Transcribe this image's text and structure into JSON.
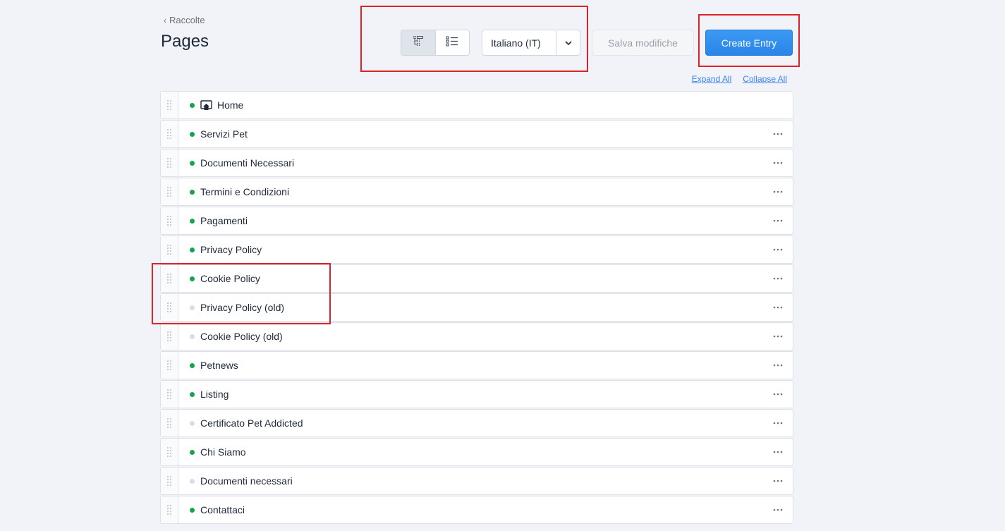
{
  "header": {
    "breadcrumb_label": "Raccolte",
    "title": "Pages",
    "locale": "Italiano (IT)",
    "save_label": "Salva modifiche",
    "create_label": "Create Entry",
    "expand_all": "Expand All",
    "collapse_all": "Collapse All"
  },
  "colors": {
    "published": "#16a34a",
    "draft": "#d9dde3",
    "primary": "#2a85e8",
    "highlight": "#d9252a"
  },
  "tree": {
    "rows": [
      {
        "label": "Home",
        "status": "published",
        "is_home": true,
        "has_menu": false
      },
      {
        "label": "Servizi Pet",
        "status": "published",
        "is_home": false,
        "has_menu": true
      },
      {
        "label": "Documenti Necessari",
        "status": "published",
        "is_home": false,
        "has_menu": true
      },
      {
        "label": "Termini e Condizioni",
        "status": "published",
        "is_home": false,
        "has_menu": true
      },
      {
        "label": "Pagamenti",
        "status": "published",
        "is_home": false,
        "has_menu": true
      },
      {
        "label": "Privacy Policy",
        "status": "published",
        "is_home": false,
        "has_menu": true
      },
      {
        "label": "Cookie Policy",
        "status": "published",
        "is_home": false,
        "has_menu": true
      },
      {
        "label": "Privacy Policy (old)",
        "status": "draft",
        "is_home": false,
        "has_menu": true
      },
      {
        "label": "Cookie Policy (old)",
        "status": "draft",
        "is_home": false,
        "has_menu": true
      },
      {
        "label": "Petnews",
        "status": "published",
        "is_home": false,
        "has_menu": true
      },
      {
        "label": "Listing",
        "status": "published",
        "is_home": false,
        "has_menu": true
      },
      {
        "label": "Certificato Pet Addicted",
        "status": "draft",
        "is_home": false,
        "has_menu": true
      },
      {
        "label": "Chi Siamo",
        "status": "published",
        "is_home": false,
        "has_menu": true
      },
      {
        "label": "Documenti necessari",
        "status": "draft",
        "is_home": false,
        "has_menu": true
      },
      {
        "label": "Contattaci",
        "status": "published",
        "is_home": false,
        "has_menu": true
      }
    ]
  }
}
